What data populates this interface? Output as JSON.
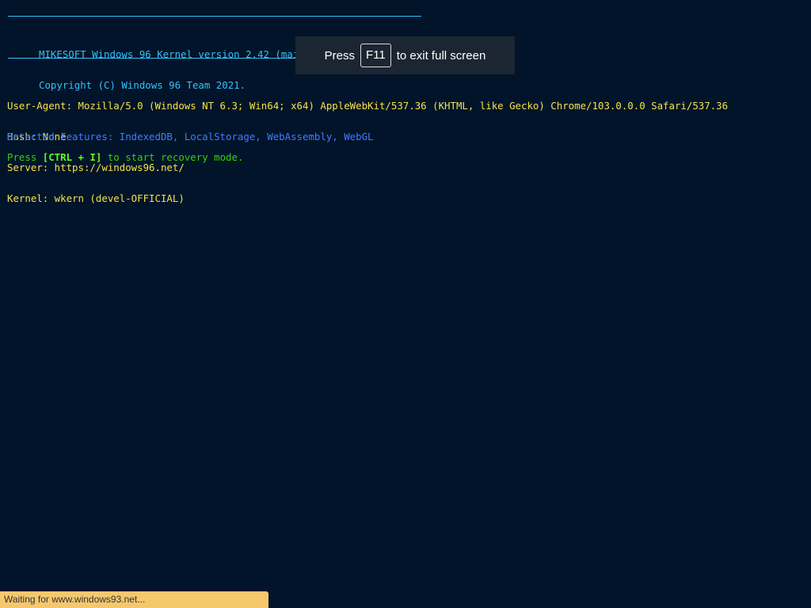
{
  "colors": {
    "background": "#021429",
    "banner_cyan": "#31c3ff",
    "info_yellow": "#f2e34a",
    "features_blue": "#3f7dff",
    "recovery_green": "#32d400",
    "status_bar_bg": "#f5c86e",
    "toast_bg": "#1c2632"
  },
  "banner": {
    "line1": "MIKESOFT Windows 96 Kernel version 2.42 (main/web).",
    "line2": "Copyright (C) Windows 96 Team 2021."
  },
  "info": {
    "user_agent": "User-Agent: Mozilla/5.0 (Windows NT 6.3; Win64; x64) AppleWebKit/537.36 (KHTML, like Gecko) Chrome/103.0.0.0 Safari/537.36",
    "hash": "Hash: None",
    "server": "Server: https://windows96.net/",
    "kernel": "Kernel: wkern (devel-OFFICIAL)"
  },
  "features": {
    "text": "Detected Features: IndexedDB, LocalStorage, WebAssembly, WebGL"
  },
  "recovery": {
    "prefix": "Press ",
    "key": "[CTRL + I]",
    "suffix": " to start recovery mode."
  },
  "fullscreen_toast": {
    "press": "Press",
    "key": "F11",
    "message": "to exit full screen"
  },
  "status_bar": {
    "text": "Waiting for www.windows93.net..."
  }
}
